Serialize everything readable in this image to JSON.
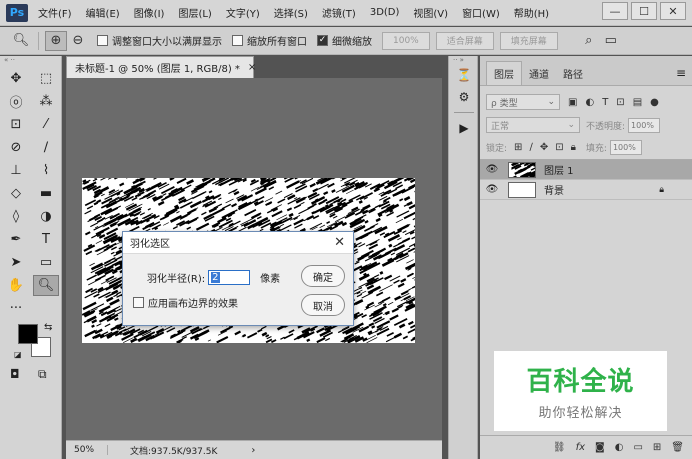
{
  "app": {
    "logo": "Ps"
  },
  "menu": [
    "文件(F)",
    "编辑(E)",
    "图像(I)",
    "图层(L)",
    "文字(Y)",
    "选择(S)",
    "滤镜(T)",
    "3D(D)",
    "视图(V)",
    "窗口(W)",
    "帮助(H)"
  ],
  "window_controls": {
    "minimize": "—",
    "restore": "☐",
    "close": "✕"
  },
  "options": {
    "resize_windows": "调整窗口大小以满屏显示",
    "zoom_all": "缩放所有窗口",
    "scrubby_zoom": "细微缩放",
    "percent_btn": "100%",
    "fit_screen": "适合屏幕",
    "fill_screen": "填充屏幕"
  },
  "document": {
    "tab_title": "未标题-1 @ 50% (图层 1, RGB/8) *",
    "tab_close": "×",
    "zoom": "50%",
    "doc_size": "文档:937.5K/937.5K",
    "status_arrow": "›"
  },
  "dialog": {
    "title": "羽化选区",
    "close": "✕",
    "radius_label": "羽化半径(R):",
    "radius_value": "2",
    "unit": "像素",
    "ok": "确定",
    "cancel": "取消",
    "apply_edges": "应用画布边界的效果"
  },
  "layers_panel": {
    "tabs": [
      "图层",
      "通道",
      "路径"
    ],
    "menu": "≡",
    "filter_kind": "ρ 类型",
    "blend_mode": "正常",
    "opacity_label": "不透明度:",
    "opacity_value": "100%",
    "lock_label": "锁定:",
    "fill_label": "填充:",
    "fill_value": "100%",
    "layers": [
      {
        "name": "图层 1",
        "selected": true
      },
      {
        "name": "背景",
        "selected": false
      }
    ],
    "bottom_icons": [
      "link-icon",
      "fx-icon",
      "mask-icon",
      "adjustment-icon",
      "group-icon",
      "new-layer-icon",
      "trash-icon"
    ]
  },
  "watermark": {
    "main": "百科全说",
    "sub": "助你轻松解决",
    "color": "#2fb24a"
  }
}
